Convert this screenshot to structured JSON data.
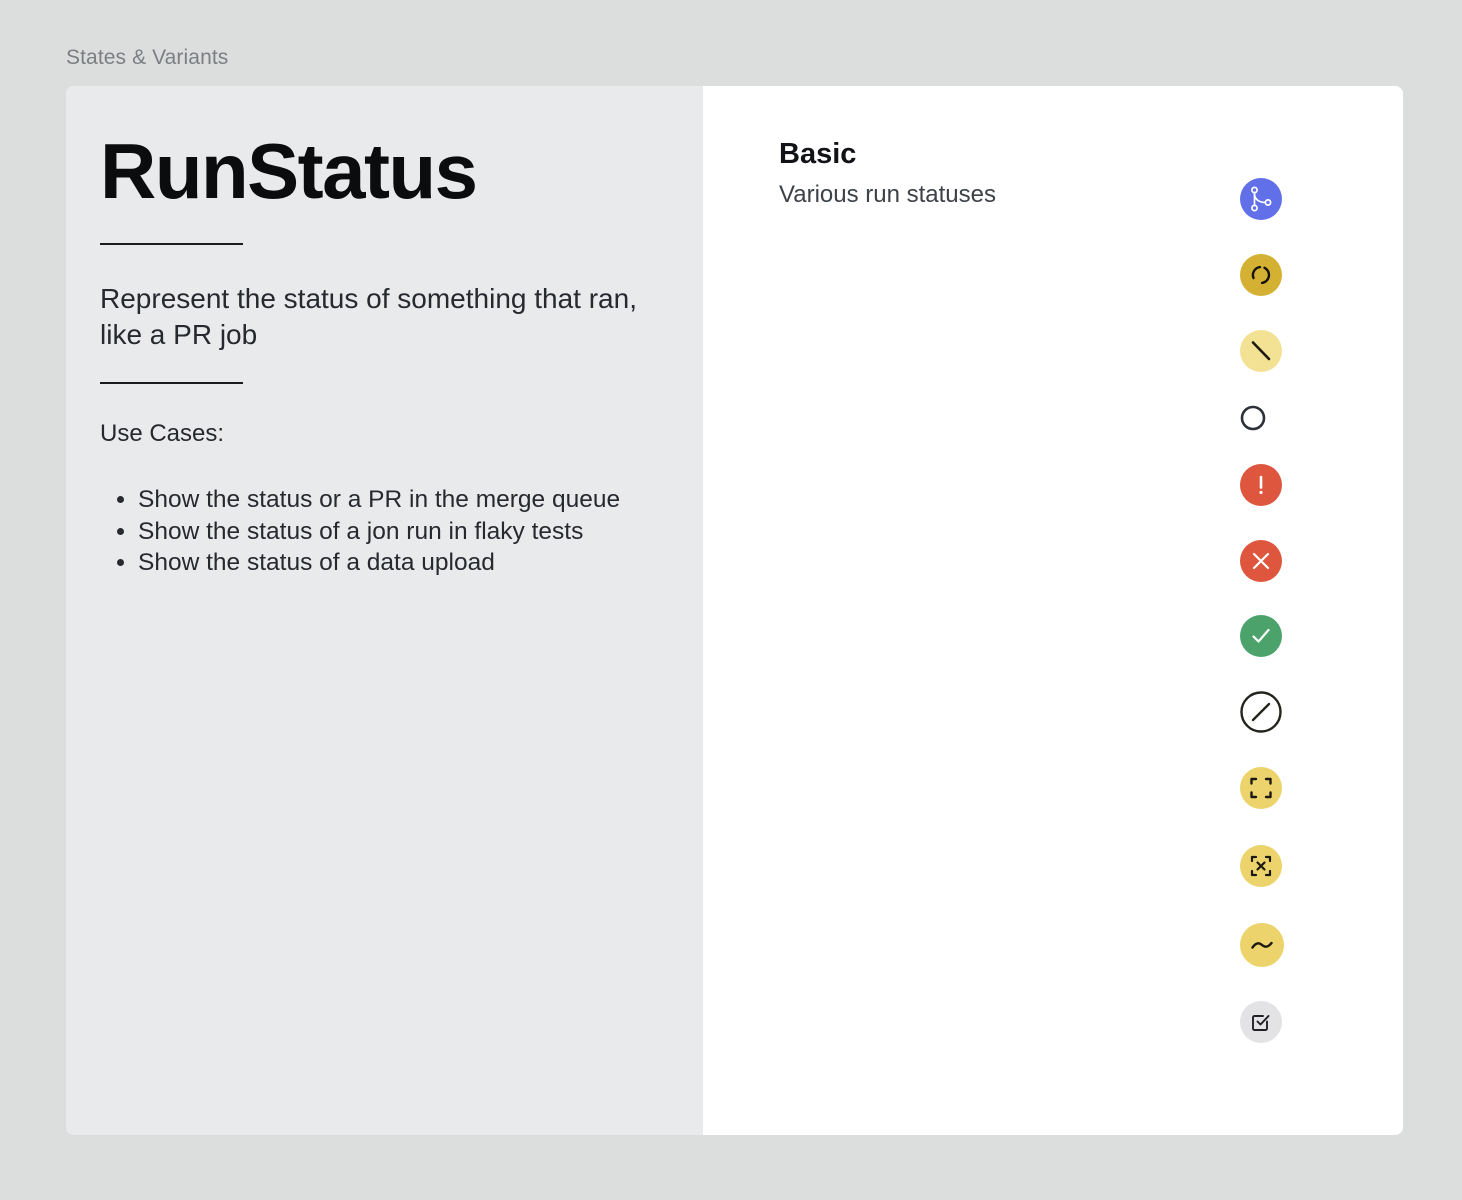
{
  "page": {
    "label": "States & Variants"
  },
  "left": {
    "title": "RunStatus",
    "description": "Represent the status of something that ran, like a PR job",
    "use_cases_heading": "Use Cases:",
    "use_cases": [
      "Show the status or a PR in the merge queue",
      "Show the status of a jon run in flaky tests",
      "Show the status of a data upload"
    ]
  },
  "right": {
    "section_title": "Basic",
    "section_description": "Various run statuses",
    "statuses": [
      {
        "icon": "branch-merge-icon",
        "color": "#6170e8"
      },
      {
        "icon": "spinner-icon",
        "color": "#d4b133"
      },
      {
        "icon": "slash-icon",
        "color": "#f3e194"
      },
      {
        "icon": "empty-circle-icon",
        "color": "#2d3038"
      },
      {
        "icon": "exclamation-icon",
        "color": "#de563d"
      },
      {
        "icon": "x-icon",
        "color": "#de563d"
      },
      {
        "icon": "check-icon",
        "color": "#4ba36b"
      },
      {
        "icon": "cancelled-icon",
        "color": "#25241c"
      },
      {
        "icon": "focus-frame-icon",
        "color": "#ecd36b"
      },
      {
        "icon": "frame-x-icon",
        "color": "#ecd36b"
      },
      {
        "icon": "wave-icon",
        "color": "#ecd36b"
      },
      {
        "icon": "checkbox-icon",
        "color": "#e3e3e5"
      }
    ]
  }
}
